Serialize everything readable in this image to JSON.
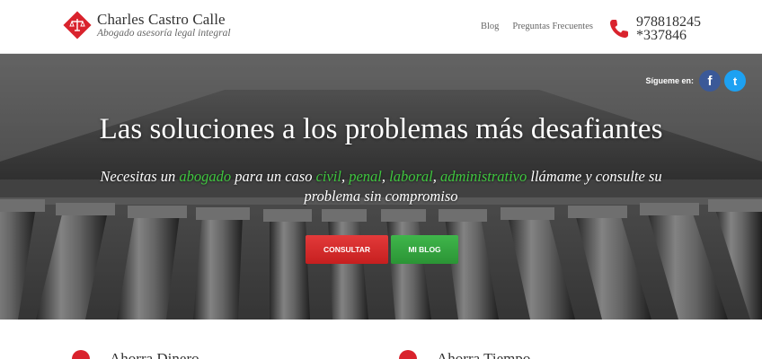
{
  "brand": {
    "name": "Charles Castro Calle",
    "tagline": "Abogado asesoría legal integral"
  },
  "nav": {
    "items": [
      "Blog",
      "Preguntas Frecuentes"
    ]
  },
  "contact": {
    "phone_line1": "978818245",
    "phone_line2": "*337846"
  },
  "social": {
    "label": "Sígueme en:",
    "facebook": "f",
    "twitter": "t"
  },
  "hero": {
    "title": "Las soluciones a los problemas más desafiantes",
    "sub_parts": {
      "p1": "Necesitas un ",
      "h1": "abogado",
      "p2": " para un caso ",
      "h2": "civil",
      "p3": ", ",
      "h3": "penal",
      "p4": ", ",
      "h4": "laboral",
      "p5": ", ",
      "h5": "administrativo",
      "p6": " llámame y consulte su problema sin compromiso"
    },
    "button_primary": "CONSULTAR",
    "button_secondary": "MI BLOG"
  },
  "features": [
    {
      "title": "Ahorra Dinero"
    },
    {
      "title": "Ahorra Tiempo"
    }
  ],
  "colors": {
    "accent_red": "#d9232d",
    "highlight_green": "#3fc73f",
    "facebook": "#3b5998",
    "twitter": "#1da1f2"
  }
}
